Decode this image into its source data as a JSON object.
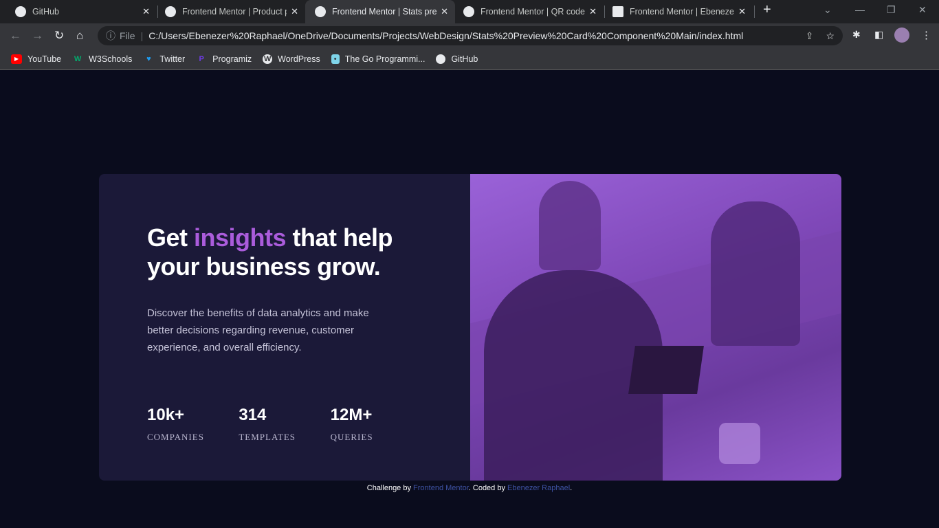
{
  "browser": {
    "tabs": [
      {
        "title": "GitHub",
        "active": false
      },
      {
        "title": "Frontend Mentor | Product p",
        "active": false
      },
      {
        "title": "Frontend Mentor | Stats prev",
        "active": true
      },
      {
        "title": "Frontend Mentor | QR code c",
        "active": false
      },
      {
        "title": "Frontend Mentor | Ebenezer",
        "active": false
      }
    ],
    "address_scheme": "File",
    "url": "C:/Users/Ebenezer%20Raphael/OneDrive/Documents/Projects/WebDesign/Stats%20Preview%20Card%20Component%20Main/index.html",
    "bookmarks": [
      {
        "label": "YouTube",
        "color": "#ff0000",
        "glyph": "▶"
      },
      {
        "label": "W3Schools",
        "color": "#04aa6d",
        "glyph": "W"
      },
      {
        "label": "Twitter",
        "color": "#1d9bf0",
        "glyph": "🐦"
      },
      {
        "label": "Programiz",
        "color": "#6f3ce8",
        "glyph": "P"
      },
      {
        "label": "WordPress",
        "color": "#e8eaed",
        "glyph": "W"
      },
      {
        "label": "The Go Programmi...",
        "color": "#7fd5ea",
        "glyph": "G"
      },
      {
        "label": "GitHub",
        "color": "#e8eaed",
        "glyph": "●"
      }
    ]
  },
  "card": {
    "heading_pre": "Get ",
    "heading_highlight": "insights",
    "heading_post": " that help your business grow.",
    "description": "Discover the benefits of data analytics and make better decisions regarding revenue, customer experience, and overall efficiency.",
    "stats": [
      {
        "value": "10k+",
        "label": "COMPANIES"
      },
      {
        "value": "314",
        "label": "TEMPLATES"
      },
      {
        "value": "12M+",
        "label": "QUERIES"
      }
    ]
  },
  "footer": {
    "pre": "Challenge by ",
    "link1": "Frontend Mentor",
    "mid": ". Coded by ",
    "link2": "Ebenezer Raphael",
    "post": "."
  }
}
